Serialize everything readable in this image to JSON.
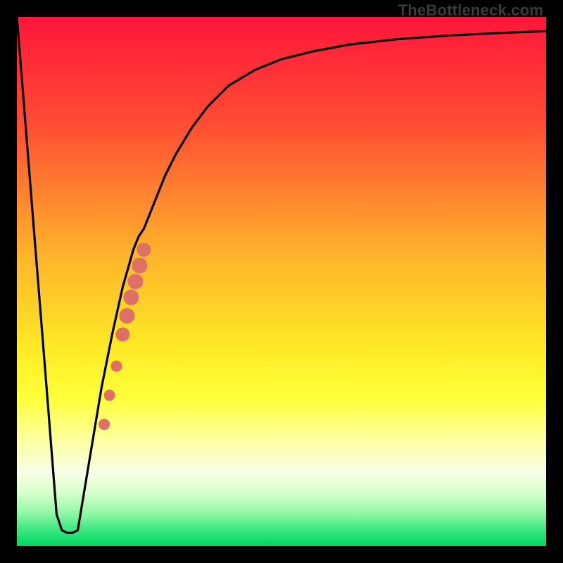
{
  "watermark": "TheBottleneck.com",
  "chart_data": {
    "type": "line",
    "title": "",
    "xlabel": "",
    "ylabel": "",
    "xlim": [
      0,
      100
    ],
    "ylim": [
      0,
      100
    ],
    "gradient_stops": [
      {
        "offset": 0.0,
        "color": "#ff163a"
      },
      {
        "offset": 0.2,
        "color": "#ff4c33"
      },
      {
        "offset": 0.45,
        "color": "#ffb32b"
      },
      {
        "offset": 0.62,
        "color": "#ffe825"
      },
      {
        "offset": 0.72,
        "color": "#ffff3a"
      },
      {
        "offset": 0.8,
        "color": "#fdffa0"
      },
      {
        "offset": 0.86,
        "color": "#f8ffe6"
      },
      {
        "offset": 0.9,
        "color": "#d6ffca"
      },
      {
        "offset": 0.94,
        "color": "#8cf7a4"
      },
      {
        "offset": 0.97,
        "color": "#38e87f"
      },
      {
        "offset": 1.0,
        "color": "#00d65e"
      }
    ],
    "series": [
      {
        "name": "bottleneck-curve",
        "x": [
          0.0,
          2.0,
          4.0,
          6.0,
          7.5,
          8.5,
          9.5,
          10.5,
          11.5,
          12.0,
          14.0,
          16.0,
          18.0,
          20.0,
          22.0,
          23.0,
          24.0,
          26.0,
          28.0,
          30.0,
          33.0,
          36.0,
          40.0,
          45.0,
          50.0,
          56.0,
          63.0,
          72.0,
          82.0,
          92.0,
          100.0
        ],
        "values": [
          100.0,
          75.0,
          50.0,
          25.0,
          6.0,
          3.0,
          2.5,
          2.5,
          3.0,
          6.0,
          18.0,
          30.0,
          40.0,
          49.0,
          56.0,
          58.5,
          60.0,
          65.0,
          70.0,
          74.0,
          79.0,
          83.0,
          87.0,
          90.0,
          92.0,
          93.5,
          94.8,
          95.8,
          96.5,
          97.0,
          97.3
        ]
      }
    ],
    "markers": {
      "name": "highlight-dots",
      "color": "#e06f66",
      "points": [
        {
          "x": 16.5,
          "y": 23.0,
          "r": 8
        },
        {
          "x": 17.5,
          "y": 28.5,
          "r": 8
        },
        {
          "x": 18.8,
          "y": 34.0,
          "r": 8
        },
        {
          "x": 20.0,
          "y": 40.0,
          "r": 10
        },
        {
          "x": 20.8,
          "y": 43.5,
          "r": 11
        },
        {
          "x": 21.6,
          "y": 47.0,
          "r": 11
        },
        {
          "x": 22.4,
          "y": 50.0,
          "r": 11
        },
        {
          "x": 23.2,
          "y": 53.0,
          "r": 11
        },
        {
          "x": 24.0,
          "y": 56.0,
          "r": 10
        }
      ]
    }
  }
}
